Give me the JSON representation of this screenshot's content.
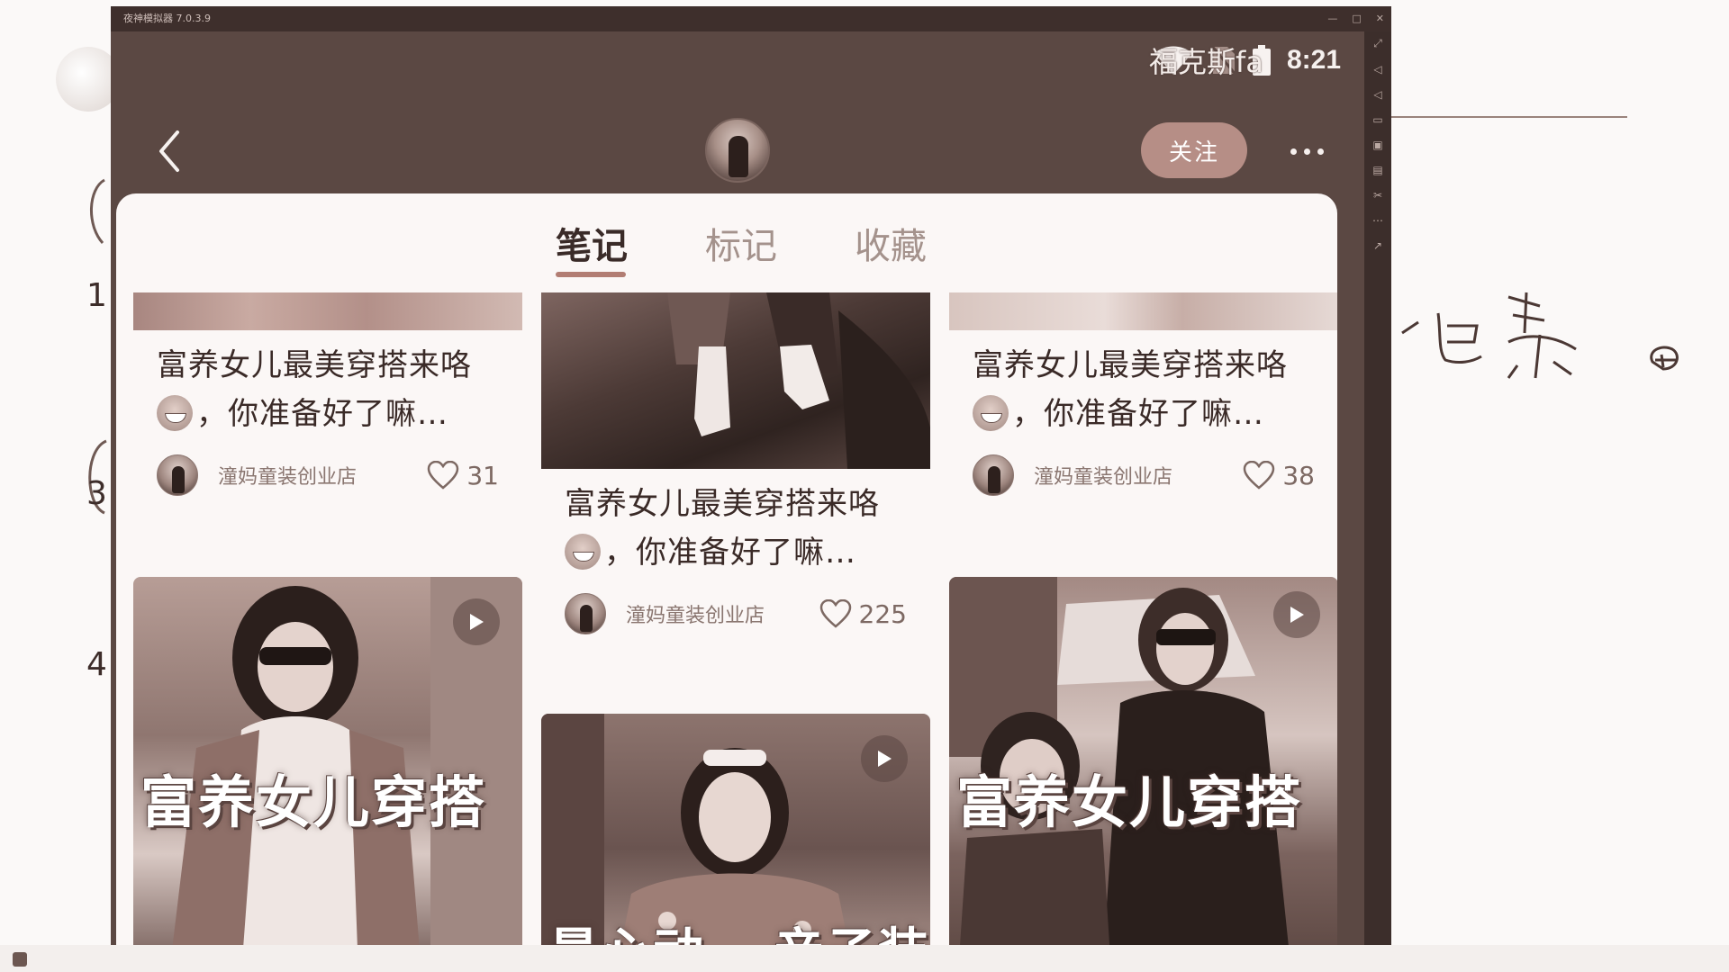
{
  "emulator": {
    "title": "夜神模拟器 7.0.3.9",
    "window_controls": [
      "—",
      "□",
      "✕"
    ]
  },
  "status_bar": {
    "time": "8:21",
    "overlay_name": "福克斯fa"
  },
  "header": {
    "follow_label": "关注"
  },
  "tabs": [
    {
      "label": "笔记",
      "active": true
    },
    {
      "label": "标记",
      "active": false
    },
    {
      "label": "收藏",
      "active": false
    }
  ],
  "notes": [
    {
      "title_line1": "富养女儿最美穿搭来咯",
      "title_line2": "，你准备好了嘛…",
      "author": "潼妈童装创业店",
      "likes": "31"
    },
    {
      "title_line1": "富养女儿最美穿搭来咯",
      "title_line2": "，你准备好了嘛…",
      "author": "潼妈童装创业店",
      "likes": "225"
    },
    {
      "title_line1": "富养女儿最美穿搭来咯",
      "title_line2": "，你准备好了嘛…",
      "author": "潼妈童装创业店",
      "likes": "38"
    }
  ],
  "video_cards": [
    {
      "caption": "富养女儿穿搭"
    },
    {
      "caption_left": "最心动",
      "caption_right": "亲子装"
    },
    {
      "caption": "富养女儿穿搭"
    }
  ],
  "colors": {
    "accent": "#b27d73",
    "follow_button": "#b68e86",
    "header_bg": "#5b4843"
  }
}
